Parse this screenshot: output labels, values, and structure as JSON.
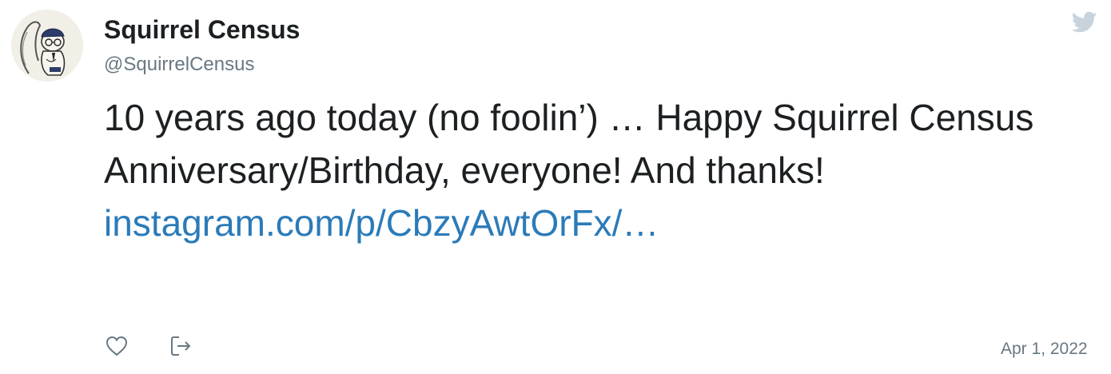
{
  "author": {
    "display_name": "Squirrel Census",
    "handle": "@SquirrelCensus",
    "avatar_icon": "squirrel-sketch-icon"
  },
  "tweet": {
    "text": "10 years ago today (no foolin’) … Happy Squirrel Census Anniversary/Birthday, everyone! And thanks! ",
    "link_text": "instagram.com/p/CbzyAwtOrFx/…",
    "date": "Apr 1, 2022"
  },
  "icons": {
    "brand": "twitter-bird-icon",
    "like": "heart-icon",
    "share": "share-icon"
  },
  "colors": {
    "text": "#1c2022",
    "secondary": "#697882",
    "link": "#2b7bb9",
    "icon": "#697882",
    "bird": "#c8d3db"
  }
}
